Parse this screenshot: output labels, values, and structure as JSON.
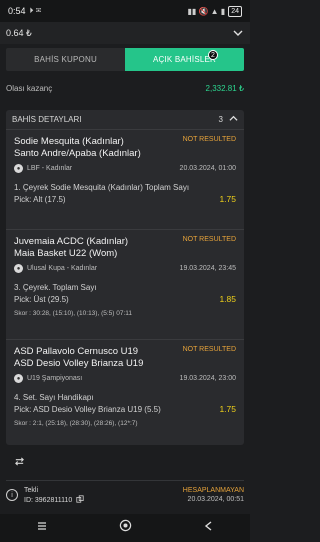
{
  "status_bar": {
    "time": "0:54",
    "icons": "⏵ ✉",
    "right_glyphs": "▮▮ 🔇 ▲ ▮",
    "battery": "24"
  },
  "top_bar": {
    "balance": "0.64 ₺"
  },
  "tabs": [
    {
      "label": "BAHİS KUPONU"
    },
    {
      "label": "AÇIK BAHİSLER",
      "badge": "2"
    }
  ],
  "gain": {
    "label": "Olası kazanç",
    "value": "2,332.81 ₺"
  },
  "details": {
    "title": "BAHİS DETAYLARI",
    "count": "3",
    "bets": [
      {
        "team1": "Sodie Mesquita (Kadınlar)",
        "team2": "Santo Andre/Apaba (Kadınlar)",
        "status": "NOT RESULTED",
        "league": "LBF - Kadınlar",
        "datetime": "20.03.2024, 01:00",
        "market": "1. Çeyrek Sodie Mesquita (Kadınlar) Toplam Sayı",
        "pick": "Pick: Alt (17.5)",
        "odds": "1.75",
        "score": ""
      },
      {
        "team1": "Juvemaia ACDC (Kadınlar)",
        "team2": "Maia Basket U22 (Wom)",
        "status": "NOT RESULTED",
        "league": "Ulusal Kupa - Kadınlar",
        "datetime": "19.03.2024, 23:45",
        "market": "3. Çeyrek. Toplam Sayı",
        "pick": "Pick: Üst (29.5)",
        "odds": "1.85",
        "score": "Skor : 30:28, (15:10), (10:13), (5:5) 07:11"
      },
      {
        "team1": "ASD Pallavolo Cernusco U19",
        "team2": "ASD Desio Volley Brianza U19",
        "status": "NOT RESULTED",
        "league": "U19 Şampiyonası",
        "datetime": "19.03.2024, 23:00",
        "market": "4. Set. Sayı Handikapı",
        "pick": "Pick: ASD Desio Volley Brianza U19 (5.5)",
        "odds": "1.75",
        "score": "Skor : 2:1, (25:18), (28:30), (28:26), (12*:7)"
      }
    ]
  },
  "bottom": {
    "type": "Tekli",
    "id": "ID: 3962811110",
    "status": "HESAPLANMAYAN",
    "datetime": "20.03.2024, 00:51"
  },
  "colors": {
    "accent": "#25c58a",
    "pending": "#e6a33a",
    "odds": "#f0d21a",
    "gain": "#2cd58f"
  }
}
